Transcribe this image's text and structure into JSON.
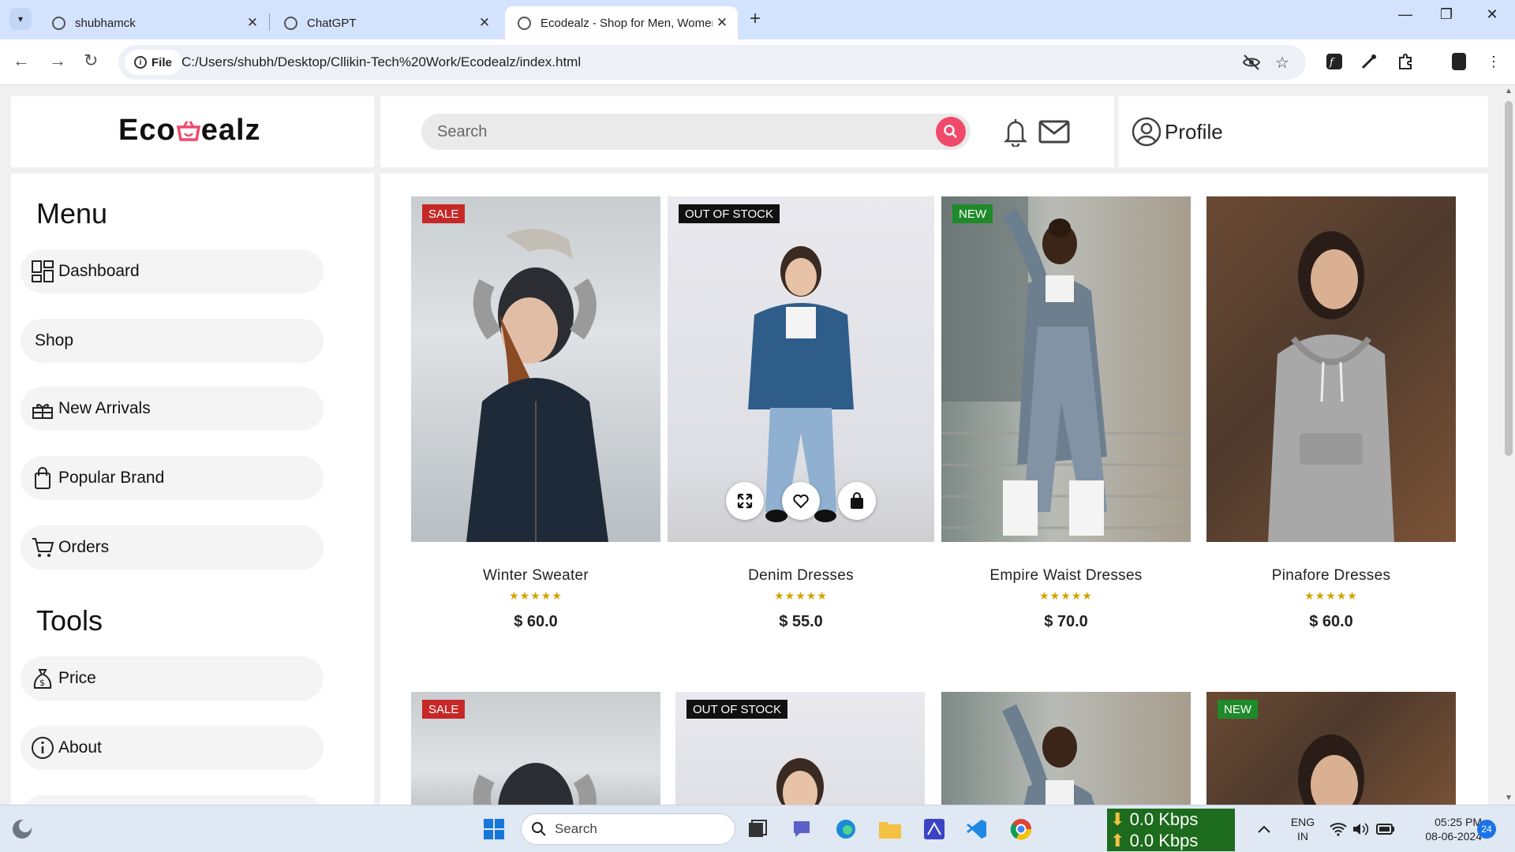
{
  "browser": {
    "tabs": [
      {
        "title": "shubhamck"
      },
      {
        "title": "ChatGPT"
      },
      {
        "title": "Ecodealz - Shop for Men, Women"
      }
    ],
    "address_chip": "File",
    "url": "C:/Users/shubh/Desktop/Cllikin-Tech%20Work/Ecodealz/index.html"
  },
  "header": {
    "logo_prefix": "Eco",
    "logo_suffix": "ealz",
    "search_placeholder": "Search",
    "profile_label": "Profile"
  },
  "sidebar": {
    "menu_heading": "Menu",
    "menu_items": [
      {
        "label": "Dashboard",
        "icon": "dashboard-icon"
      },
      {
        "label": "Shop",
        "icon": ""
      },
      {
        "label": "New Arrivals",
        "icon": "new-arrivals-icon"
      },
      {
        "label": "Popular Brand",
        "icon": "shopping-bag-icon"
      },
      {
        "label": "Orders",
        "icon": "cart-icon"
      }
    ],
    "tools_heading": "Tools",
    "tool_items": [
      {
        "label": "Price",
        "icon": "money-bag-icon"
      },
      {
        "label": "About",
        "icon": "info-icon"
      }
    ]
  },
  "products": [
    {
      "name": "Winter Sweater",
      "price": "$ 60.0",
      "badge": "SALE",
      "rating": "★★★★★"
    },
    {
      "name": "Denim Dresses",
      "price": "$ 55.0",
      "badge": "OUT OF STOCK",
      "rating": "★★★★★"
    },
    {
      "name": "Empire Waist Dresses",
      "price": "$ 70.0",
      "badge": "NEW",
      "rating": "★★★★★"
    },
    {
      "name": "Pinafore Dresses",
      "price": "$ 60.0",
      "badge": "",
      "rating": "★★★★★"
    }
  ],
  "products_row2_badges": [
    "SALE",
    "OUT OF STOCK",
    "",
    "NEW"
  ],
  "taskbar": {
    "search_label": "Search",
    "net_down": "0.0 Kbps",
    "net_up": "0.0 Kbps",
    "lang": "ENG",
    "region": "IN",
    "time": "05:25 PM",
    "date": "08-06-2024",
    "notification_count": "24"
  },
  "colors": {
    "accent": "#f04a6b",
    "sale": "#c62828",
    "new": "#1f8a2a",
    "star": "#d3a300"
  }
}
